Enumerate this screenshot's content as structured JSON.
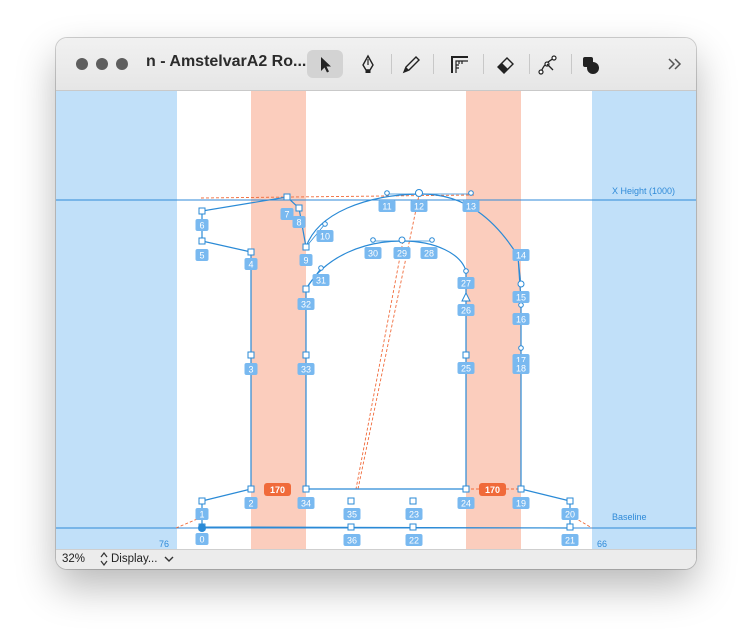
{
  "window": {
    "title": "n - AmstelvarA2 Ro...",
    "traffic_lights": [
      "close-button",
      "minimize-button",
      "zoom-button"
    ]
  },
  "toolbar": {
    "tools": [
      {
        "name": "select-tool",
        "icon": "arrow-pointer-icon",
        "active": true
      },
      {
        "name": "pen-tool",
        "icon": "pen-nib-icon",
        "active": false
      },
      {
        "name": "pencil-tool",
        "icon": "pencil-icon",
        "active": false
      },
      {
        "name": "measure-tool",
        "icon": "ruler-corner-icon",
        "active": false
      },
      {
        "name": "eraser-tool",
        "icon": "eraser-icon",
        "active": false
      },
      {
        "name": "knife-tool",
        "icon": "node-knife-icon",
        "active": false
      },
      {
        "name": "shapes-tool",
        "icon": "shapes-icon",
        "active": false
      }
    ],
    "overflow_icon": "double-chevron-right-icon"
  },
  "canvas": {
    "guides": {
      "x_height_label": "X Height (1000)",
      "baseline_label": "Baseline"
    },
    "sidebearings": {
      "left": "76",
      "right": "66"
    },
    "stem_measurements": [
      "170",
      "170"
    ],
    "point_labels": [
      "0",
      "1",
      "2",
      "3",
      "4",
      "5",
      "6",
      "7",
      "8",
      "9",
      "10",
      "11",
      "12",
      "13",
      "14",
      "15",
      "16",
      "17",
      "18",
      "19",
      "20",
      "21",
      "22",
      "23",
      "24",
      "25",
      "26",
      "27",
      "28",
      "29",
      "30",
      "31",
      "32",
      "33",
      "34",
      "35",
      "36",
      "0"
    ],
    "colors": {
      "margin_fill": "#c1e0f9",
      "stem_fill": "#fbcdbd",
      "guide_line": "#2f8ad8",
      "contour": "#2a8ad6",
      "label_bg": "#79b9f0",
      "measurement": "#f06a3a",
      "anchor_label": "#b37be8"
    }
  },
  "statusbar": {
    "zoom": "32%",
    "display_menu": "Display...",
    "display_icon": "up-down-arrows-icon",
    "dropdown_icon": "chevron-down-icon"
  }
}
